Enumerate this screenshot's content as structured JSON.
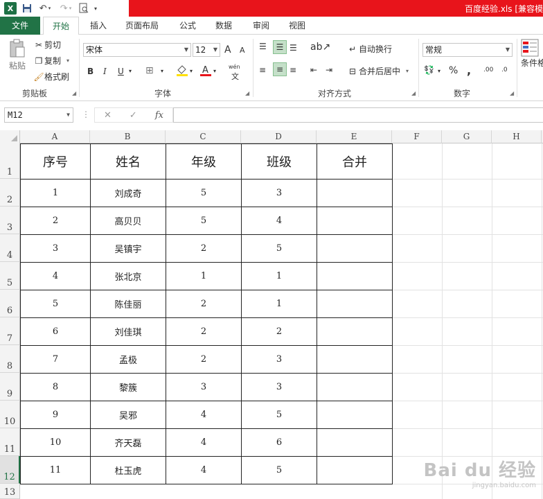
{
  "titlebar": {
    "title": "百度经验.xls  [兼容模",
    "accent": "#e8141b"
  },
  "qat": {
    "app_icon": "excel-icon",
    "save_icon": "save-icon",
    "undo_icon": "undo-icon",
    "redo_icon": "redo-icon",
    "preview_icon": "print-preview-icon"
  },
  "tabs": [
    "文件",
    "开始",
    "插入",
    "页面布局",
    "公式",
    "数据",
    "审阅",
    "视图"
  ],
  "ribbon": {
    "clipboard": {
      "paste": "粘贴",
      "cut": "剪切",
      "copy": "复制",
      "format_painter": "格式刷",
      "label": "剪贴板"
    },
    "font": {
      "name": "宋体",
      "size": "12",
      "grow": "A",
      "shrink": "A",
      "bold": "B",
      "italic": "I",
      "underline": "U",
      "phonetic": "wén",
      "label": "字体"
    },
    "alignment": {
      "wrap_text": "自动换行",
      "merge_center": "合并后居中",
      "label": "对齐方式"
    },
    "number": {
      "format": "常规",
      "percent": "%",
      "comma": ",",
      "inc_decimal": ".00",
      "dec_decimal": ".0",
      "label": "数字"
    },
    "styles": {
      "conditional": "条件格"
    }
  },
  "formula_bar": {
    "name_box": "M12",
    "cancel": "✕",
    "enter": "✓",
    "fx": "fx",
    "formula": ""
  },
  "sheet": {
    "columns": [
      "A",
      "B",
      "C",
      "D",
      "E",
      "F",
      "G",
      "H"
    ],
    "rows": [
      "1",
      "2",
      "3",
      "4",
      "5",
      "6",
      "7",
      "8",
      "9",
      "10",
      "11",
      "12",
      "13"
    ],
    "selected_row": "12",
    "header": [
      "序号",
      "姓名",
      "年级",
      "班级",
      "合并"
    ],
    "data": [
      [
        "1",
        "刘成奇",
        "5",
        "3",
        ""
      ],
      [
        "2",
        "高贝贝",
        "5",
        "4",
        ""
      ],
      [
        "3",
        "吴镇宇",
        "2",
        "5",
        ""
      ],
      [
        "4",
        "张北京",
        "1",
        "1",
        ""
      ],
      [
        "5",
        "陈佳丽",
        "2",
        "1",
        ""
      ],
      [
        "6",
        "刘佳琪",
        "2",
        "2",
        ""
      ],
      [
        "7",
        "孟极",
        "2",
        "3",
        ""
      ],
      [
        "8",
        "黎簇",
        "3",
        "3",
        ""
      ],
      [
        "9",
        "吴邪",
        "4",
        "5",
        ""
      ],
      [
        "10",
        "齐天磊",
        "4",
        "6",
        ""
      ],
      [
        "11",
        "杜玉虎",
        "4",
        "5",
        ""
      ]
    ]
  },
  "watermark": {
    "brand": "Bai du 经验",
    "url": "jingyan.baidu.com"
  }
}
